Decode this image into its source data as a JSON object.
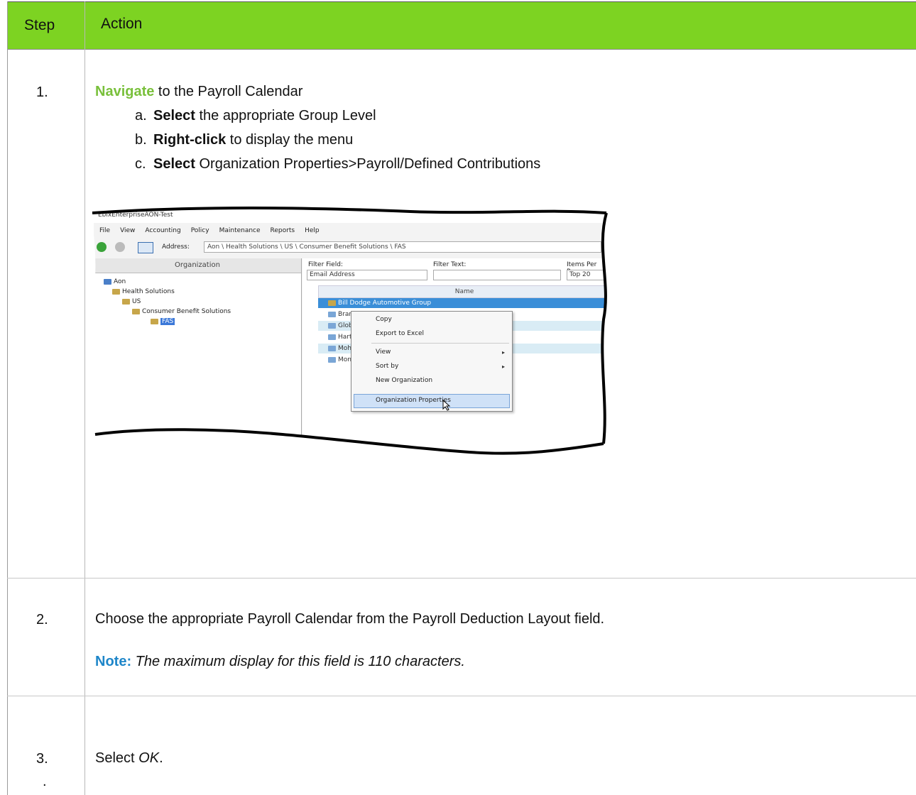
{
  "header": {
    "step": "Step",
    "action": "Action"
  },
  "steps": [
    {
      "number": "1.",
      "verb": "Navigate",
      "text": " to the Payroll Calendar",
      "substeps": [
        {
          "marker": "a.",
          "verb": "Select",
          "text": " the appropriate Group Level"
        },
        {
          "marker": "b.",
          "verb": "Right-click",
          "text": " to display the menu"
        },
        {
          "marker": "c.",
          "verb": "Select",
          "text": " Organization Properties>Payroll/Defined Contributions"
        }
      ]
    },
    {
      "number": "2.",
      "text": "Choose the appropriate Payroll Calendar from the Payroll Deduction Layout field.",
      "note_label": "Note:",
      "note_text": " The maximum display for this field is 110 characters."
    },
    {
      "number": "3.",
      "number_tail": ".",
      "text_prefix": "Select ",
      "text_em": "OK",
      "text_suffix": "."
    }
  ],
  "screenshot": {
    "title": "EbixEnterpriseAON-Test",
    "menu": [
      "File",
      "View",
      "Accounting",
      "Policy",
      "Maintenance",
      "Reports",
      "Help"
    ],
    "address_label": "Address:",
    "address_value": "Aon \\ Health Solutions \\ US \\ Consumer Benefit Solutions \\ FAS",
    "org_header": "Organization",
    "tree": [
      "Aon",
      "Health Solutions",
      "US",
      "Consumer Benefit Solutions",
      "FAS"
    ],
    "filter_field_label": "Filter Field:",
    "filter_field_value": "Email Address",
    "filter_text_label": "Filter Text:",
    "items_per_page_label": "Items Per Page",
    "items_per_page_value": "Top 20",
    "name_header": "Name",
    "rows": [
      "Bill Dodge Automotive Group",
      "Brand",
      "Globe",
      "Hartfo",
      "Mohe",
      "Montz"
    ],
    "context_menu": [
      "Copy",
      "Export to Excel",
      "View",
      "Sort by",
      "New Organization",
      "Organization Properties"
    ]
  }
}
